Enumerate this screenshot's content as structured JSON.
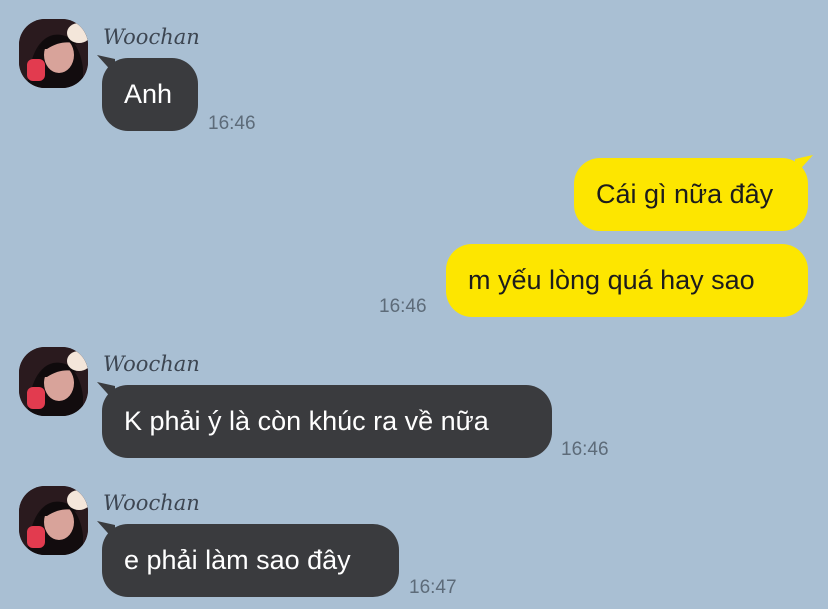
{
  "chat": {
    "messages": [
      {
        "direction": "incoming",
        "sender": "Woochan",
        "text": "Anh",
        "time": "16:46"
      },
      {
        "direction": "outgoing",
        "text": "Cái gì nữa đây",
        "time": ""
      },
      {
        "direction": "outgoing",
        "text": "m yếu lòng quá hay sao",
        "time": "16:46"
      },
      {
        "direction": "incoming",
        "sender": "Woochan",
        "text": "K phải ý là còn khúc ra về nữa",
        "time": "16:46"
      },
      {
        "direction": "incoming",
        "sender": "Woochan",
        "text": "e phải làm sao đây",
        "time": "16:47"
      }
    ]
  },
  "colors": {
    "background": "#a9bfd3",
    "incoming_bubble": "#3a3b3e",
    "outgoing_bubble": "#fde600",
    "timestamp": "#5d6b79"
  }
}
